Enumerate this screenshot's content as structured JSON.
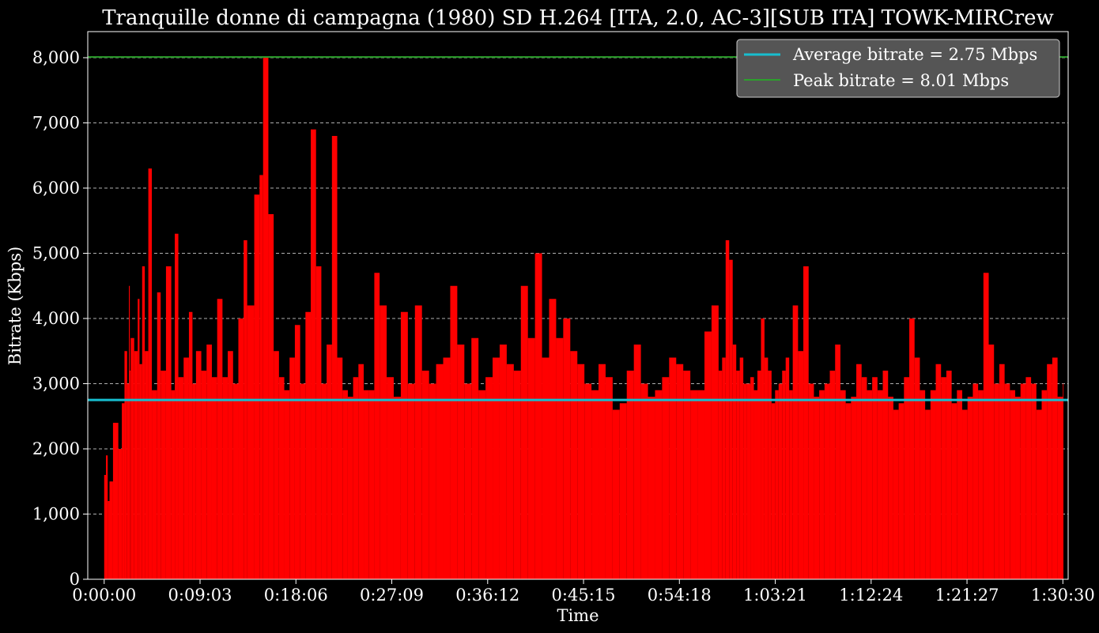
{
  "chart_data": {
    "type": "area",
    "title": "Tranquille donne di campagna (1980) SD H.264 [ITA, 2.0, AC-3][SUB ITA] TOWK-MIRCrew",
    "xlabel": "Time",
    "ylabel": "Bitrate (Kbps)",
    "xlim_seconds": [
      -93,
      5460
    ],
    "ylim": [
      0,
      8400
    ],
    "x_tick_labels": [
      "0:00:00",
      "0:09:03",
      "0:18:06",
      "0:27:09",
      "0:36:12",
      "0:45:15",
      "0:54:18",
      "1:03:21",
      "1:12:24",
      "1:21:27",
      "1:30:30"
    ],
    "x_tick_seconds": [
      0,
      543,
      1086,
      1629,
      2172,
      2715,
      3258,
      3801,
      4344,
      4887,
      5430
    ],
    "y_ticks": [
      0,
      1000,
      2000,
      3000,
      4000,
      5000,
      6000,
      7000,
      8000
    ],
    "y_tick_labels": [
      "0",
      "1,000",
      "2,000",
      "3,000",
      "4,000",
      "5,000",
      "6,000",
      "7,000",
      "8,000"
    ],
    "grid": "y-dashed",
    "legend_position": "top-right",
    "series": [
      {
        "name": "Bitrate",
        "color": "#ff0000",
        "x_seconds": [
          0,
          10,
          20,
          30,
          50,
          80,
          100,
          115,
          130,
          140,
          145,
          150,
          170,
          190,
          200,
          215,
          230,
          250,
          270,
          300,
          320,
          350,
          380,
          400,
          420,
          450,
          480,
          500,
          520,
          550,
          580,
          610,
          640,
          670,
          700,
          730,
          760,
          790,
          810,
          850,
          880,
          900,
          930,
          960,
          990,
          1020,
          1050,
          1080,
          1110,
          1140,
          1170,
          1200,
          1230,
          1260,
          1290,
          1320,
          1350,
          1380,
          1410,
          1440,
          1470,
          1500,
          1530,
          1560,
          1600,
          1640,
          1680,
          1720,
          1760,
          1800,
          1840,
          1880,
          1920,
          1960,
          2000,
          2040,
          2080,
          2120,
          2160,
          2200,
          2240,
          2280,
          2320,
          2360,
          2400,
          2440,
          2480,
          2520,
          2560,
          2600,
          2640,
          2680,
          2720,
          2760,
          2800,
          2840,
          2880,
          2920,
          2960,
          3000,
          3040,
          3080,
          3120,
          3160,
          3200,
          3240,
          3280,
          3320,
          3360,
          3400,
          3440,
          3480,
          3500,
          3520,
          3540,
          3560,
          3580,
          3600,
          3620,
          3640,
          3660,
          3680,
          3700,
          3720,
          3740,
          3760,
          3780,
          3800,
          3820,
          3840,
          3860,
          3880,
          3900,
          3930,
          3960,
          3990,
          4020,
          4050,
          4080,
          4110,
          4140,
          4170,
          4200,
          4230,
          4260,
          4290,
          4320,
          4350,
          4380,
          4410,
          4440,
          4470,
          4500,
          4530,
          4560,
          4590,
          4620,
          4650,
          4680,
          4710,
          4740,
          4770,
          4800,
          4830,
          4860,
          4890,
          4920,
          4950,
          4980,
          5010,
          5040,
          5070,
          5100,
          5130,
          5160,
          5190,
          5220,
          5250,
          5280,
          5310,
          5340,
          5370,
          5400,
          5430
        ],
        "values": [
          1600,
          1900,
          1200,
          1500,
          2400,
          2000,
          2700,
          3500,
          3000,
          4500,
          3200,
          3700,
          3500,
          4300,
          3300,
          4800,
          3500,
          6300,
          2900,
          4400,
          3200,
          4800,
          2900,
          5300,
          3100,
          3400,
          4100,
          3000,
          3500,
          3200,
          3600,
          3100,
          4300,
          3100,
          3500,
          3000,
          4000,
          5200,
          4200,
          5900,
          6200,
          8000,
          5600,
          3500,
          3100,
          2900,
          3400,
          3900,
          3000,
          4100,
          6900,
          4800,
          3000,
          3600,
          6800,
          3400,
          2900,
          2800,
          3100,
          3300,
          2900,
          2900,
          4700,
          4200,
          3100,
          2800,
          4100,
          3000,
          4200,
          3200,
          3000,
          3300,
          3400,
          4500,
          3600,
          3000,
          3700,
          2900,
          3100,
          3400,
          3600,
          3300,
          3200,
          4500,
          3700,
          5000,
          3400,
          4300,
          3700,
          4000,
          3500,
          3300,
          3000,
          2900,
          3300,
          3100,
          2600,
          2700,
          3200,
          3600,
          3000,
          2800,
          2900,
          3100,
          3400,
          3300,
          3200,
          2900,
          2900,
          3800,
          4200,
          3200,
          3400,
          5200,
          4900,
          3600,
          3200,
          3400,
          3000,
          3000,
          3100,
          2900,
          3200,
          4000,
          3400,
          3200,
          2700,
          2900,
          3000,
          3200,
          3400,
          2900,
          4200,
          3500,
          4800,
          3000,
          2800,
          2900,
          3000,
          3200,
          3600,
          2900,
          2700,
          2800,
          3300,
          3100,
          2900,
          3100,
          2900,
          3200,
          2800,
          2600,
          2700,
          3100,
          4000,
          3400,
          2900,
          2600,
          2900,
          3300,
          3100,
          3200,
          2700,
          2900,
          2600,
          2800,
          3000,
          2900,
          4700,
          3600,
          3000,
          3300,
          3000,
          2900,
          2800,
          3000,
          3100,
          3000,
          2600,
          2900,
          3300,
          3400,
          2800,
          3000,
          3200,
          3600,
          3300,
          2600,
          2700,
          2900,
          3200,
          2600,
          3000,
          2700,
          3200
        ]
      }
    ],
    "reference_lines": [
      {
        "label": "Average bitrate = 2.75 Mbps",
        "value": 2750,
        "color": "#17becf"
      },
      {
        "label": "Peak bitrate = 8.01 Mbps",
        "value": 8010,
        "color": "#2ca02c"
      }
    ],
    "colors": {
      "background": "#000000",
      "axes": "#ffffff",
      "grid": "#b0b0b0",
      "legend_face": "#555555",
      "legend_edge": "#cccccc"
    }
  }
}
